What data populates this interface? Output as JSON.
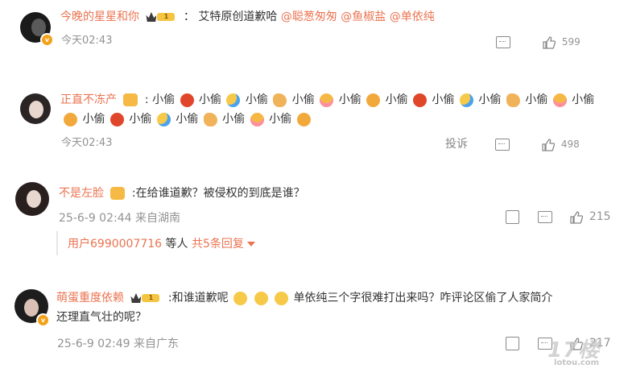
{
  "comments": [
    {
      "username": "今晚的星星和你",
      "separator": "：",
      "text": "艾特原创道歉哈",
      "mentions": [
        "@聪葱匆匆",
        "@鱼椒盐",
        "@单依纯"
      ],
      "time": "今天02:43",
      "likes": "599",
      "badge": "1"
    },
    {
      "username": "正直不冻产",
      "word": "小偷",
      "time": "今天02:43",
      "report_label": "投诉",
      "likes": "498"
    },
    {
      "username": "不是左脸",
      "text": ":在给谁道歉？被侵权的到底是谁？",
      "time": "25-6-9 02:44",
      "location": "来自湖南",
      "likes": "215",
      "reply_summary": {
        "user": "用户6990007716",
        "mid": " 等人 ",
        "count": "共5条回复"
      }
    },
    {
      "username": "萌蛋重度依赖",
      "badge": "1",
      "text_a": ":和谁道歉呢",
      "text_b": "单依纯三个字很难打出来吗？咋评论区偷了人家简介",
      "text_c": "还理直气壮的呢？",
      "time": "25-6-9 02:49",
      "location": "来自广东",
      "likes": "217"
    }
  ],
  "watermark": {
    "big": "17楼",
    "small": "lotou.com"
  },
  "colors": {
    "username": "#eb7350",
    "meta": "#939393",
    "text": "#333333"
  }
}
